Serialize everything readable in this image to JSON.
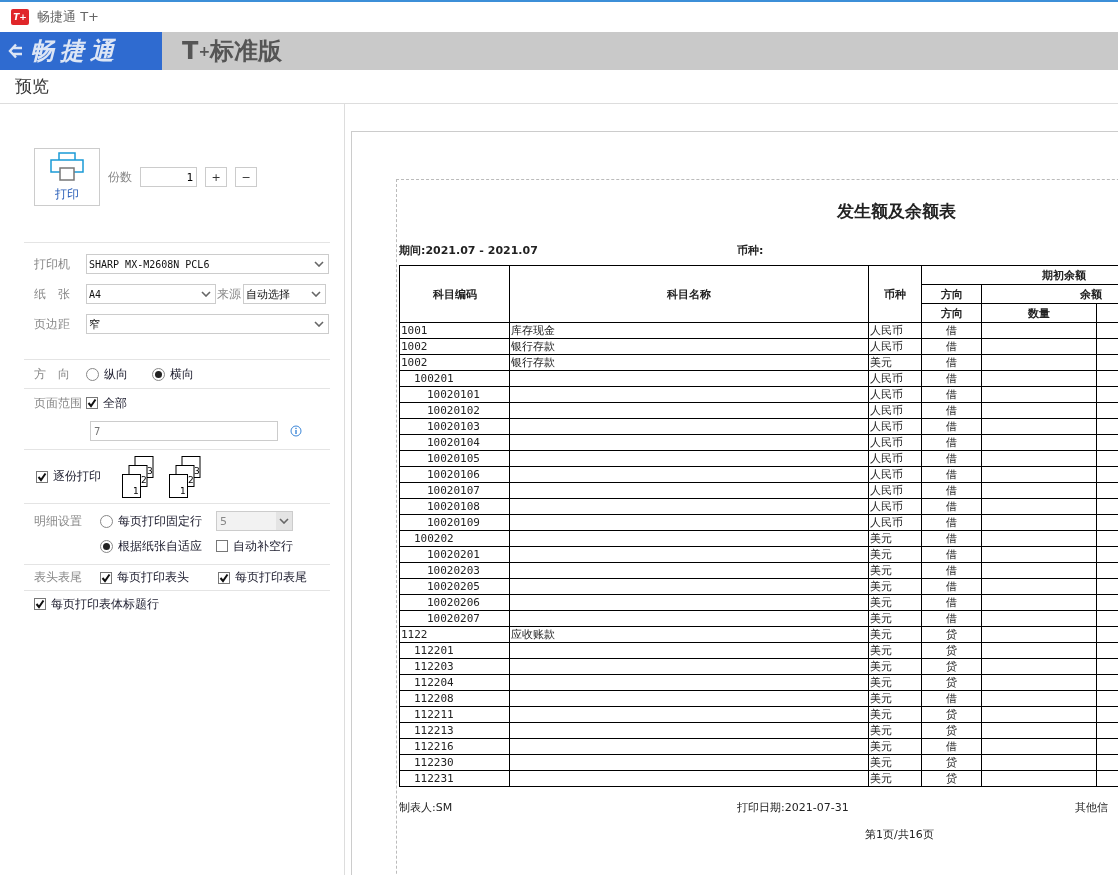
{
  "app": {
    "logo": "T+",
    "title": "畅捷通 T+"
  },
  "header": {
    "brand": "畅捷通",
    "product": "T$^{+}$标准版"
  },
  "dialog": {
    "title": "预览"
  },
  "print": {
    "button": "打印",
    "copies_label": "份数",
    "copies": "1",
    "plus": "+",
    "minus": "−"
  },
  "printer": {
    "label": "打印机",
    "value": "SHARP MX-M2608N PCL6"
  },
  "paper": {
    "label": "纸　张",
    "value": "A4",
    "source_label": "来源",
    "source": "自动选择"
  },
  "margin": {
    "label": "页边距",
    "value": "窄"
  },
  "orientation": {
    "label": "方　向",
    "options": [
      {
        "label": "纵向",
        "selected": false
      },
      {
        "label": "横向",
        "selected": true
      }
    ]
  },
  "range": {
    "label": "页面范围",
    "all": {
      "label": "全部",
      "checked": true
    },
    "pages": {
      "placeholder": "7"
    }
  },
  "collate": {
    "label": "逐份打印",
    "checked": true,
    "icons": [
      {
        "pages": [
          "3",
          "2",
          "1"
        ]
      },
      {
        "pages": [
          "3",
          "2",
          "1"
        ]
      }
    ]
  },
  "detail": {
    "label": "明细设置",
    "options": [
      {
        "label": "每页打印固定行",
        "selected": false
      },
      {
        "label": "根据纸张自适应",
        "selected": true
      }
    ],
    "rows": {
      "value": "5",
      "disabled": true
    },
    "fill_blank": {
      "label": "自动补空行",
      "checked": false
    }
  },
  "header_footer": {
    "label": "表头表尾",
    "options": [
      {
        "label": "每页打印表头",
        "checked": true
      },
      {
        "label": "每页打印表尾",
        "checked": true
      }
    ]
  },
  "title_rows": {
    "label": "每页打印表体标题行",
    "checked": true
  },
  "report": {
    "title": "发生额及余额表",
    "period": "期间:2021.07 - 2021.07",
    "currency_label": "币种:",
    "columns": {
      "code": "科目编码",
      "name": "科目名称",
      "currency": "币种",
      "group": "期初余额",
      "direction": "方向",
      "balance": "余额",
      "direction_2": "方向",
      "quantity": "数量"
    },
    "rows": [
      {
        "code": "1001",
        "name": "库存现金",
        "currency": "人民币",
        "direction": "借"
      },
      {
        "code": "1002",
        "name": "银行存款",
        "currency": "人民币",
        "direction": "借"
      },
      {
        "code": "1002",
        "name": "银行存款",
        "currency": "美元",
        "direction": "借",
        "children": [
          {
            "code": "100201",
            "currency": "人民币",
            "direction": "借",
            "children": [
              {
                "code": "10020101",
                "currency": "人民币",
                "direction": "借"
              },
              {
                "code": "10020102",
                "currency": "人民币",
                "direction": "借"
              },
              {
                "code": "10020103",
                "currency": "人民币",
                "direction": "借"
              },
              {
                "code": "10020104",
                "currency": "人民币",
                "direction": "借"
              },
              {
                "code": "10020105",
                "currency": "人民币",
                "direction": "借"
              },
              {
                "code": "10020106",
                "currency": "人民币",
                "direction": "借"
              },
              {
                "code": "10020107",
                "currency": "人民币",
                "direction": "借"
              },
              {
                "code": "10020108",
                "currency": "人民币",
                "direction": "借"
              },
              {
                "code": "10020109",
                "currency": "人民币",
                "direction": "借"
              }
            ]
          },
          {
            "code": "100202",
            "currency": "美元",
            "direction": "借",
            "children": [
              {
                "code": "10020201",
                "currency": "美元",
                "direction": "借"
              },
              {
                "code": "10020203",
                "currency": "美元",
                "direction": "借"
              },
              {
                "code": "10020205",
                "currency": "美元",
                "direction": "借"
              },
              {
                "code": "10020206",
                "currency": "美元",
                "direction": "借"
              },
              {
                "code": "10020207",
                "currency": "美元",
                "direction": "借"
              }
            ]
          }
        ]
      },
      {
        "code": "1122",
        "name": "应收账款",
        "currency": "美元",
        "direction": "贷",
        "children": [
          {
            "code": "112201",
            "currency": "美元",
            "direction": "贷"
          },
          {
            "code": "112203",
            "currency": "美元",
            "direction": "贷"
          },
          {
            "code": "112204",
            "currency": "美元",
            "direction": "贷"
          },
          {
            "code": "112208",
            "currency": "美元",
            "direction": "借"
          },
          {
            "code": "112211",
            "currency": "美元",
            "direction": "贷"
          },
          {
            "code": "112213",
            "currency": "美元",
            "direction": "贷"
          },
          {
            "code": "112216",
            "currency": "美元",
            "direction": "借"
          },
          {
            "code": "112230",
            "currency": "美元",
            "direction": "贷"
          },
          {
            "code": "112231",
            "currency": "美元",
            "direction": "贷"
          }
        ]
      }
    ],
    "maker": "制表人:SM",
    "print_date": "打印日期:2021-07-31",
    "other": "其他信",
    "page_info": "第1页/共16页"
  }
}
